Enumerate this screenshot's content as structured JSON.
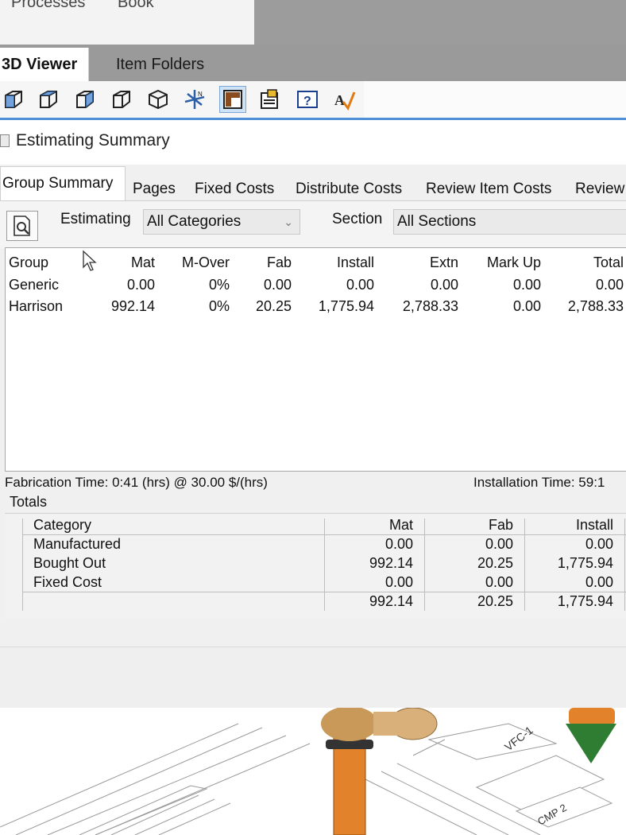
{
  "menu": {
    "processes": "Processes",
    "book": "Book"
  },
  "viewer_tabs": {
    "viewer": "3D Viewer",
    "folders": "Item Folders"
  },
  "toolbar_icons": [
    "cube-front-icon",
    "cube-iso-icon",
    "cube-side-icon",
    "cube-wire-icon",
    "cube-3d-icon",
    "axis-icon",
    "layout-icon",
    "properties-icon",
    "help-icon",
    "spell-icon"
  ],
  "dialog": {
    "title": "Estimating Summary",
    "tabs": [
      "Group Summary",
      "Pages",
      "Fixed Costs",
      "Distribute Costs",
      "Review Item Costs",
      "Review"
    ],
    "filter": {
      "estimating_label": "Estimating",
      "estimating_value": "All Categories",
      "section_label": "Section",
      "section_value": "All Sections"
    },
    "group_table": {
      "headers": [
        "Group",
        "Mat",
        "M-Over",
        "Fab",
        "Install",
        "Extn",
        "Mark Up",
        "Total"
      ],
      "rows": [
        [
          "Generic",
          "0.00",
          "0%",
          "0.00",
          "0.00",
          "0.00",
          "0.00",
          "0.00"
        ],
        [
          "Harrison",
          "992.14",
          "0%",
          "20.25",
          "1,775.94",
          "2,788.33",
          "0.00",
          "2,788.33"
        ]
      ]
    },
    "fabrication_time": "Fabrication Time: 0:41 (hrs) @ 30.00 $/(hrs)",
    "installation_time": "Installation Time: 59:1",
    "totals": {
      "label": "Totals",
      "headers": [
        "Category",
        "Mat",
        "Fab",
        "Install"
      ],
      "rows": [
        [
          "Manufactured",
          "0.00",
          "0.00",
          "0.00"
        ],
        [
          "Bought Out",
          "992.14",
          "20.25",
          "1,775.94"
        ],
        [
          "Fixed Cost",
          "0.00",
          "0.00",
          "0.00"
        ]
      ],
      "sum": [
        "",
        "992.14",
        "20.25",
        "1,775.94"
      ]
    }
  },
  "viewport_labels": {
    "vfc": "VFC-1",
    "cmp": "CMP 2"
  },
  "colors": {
    "accent": "#4f8fd6",
    "pipe_orange": "#e2832b",
    "fitting_tan": "#d9b079",
    "arrow_green": "#2e7d32"
  }
}
